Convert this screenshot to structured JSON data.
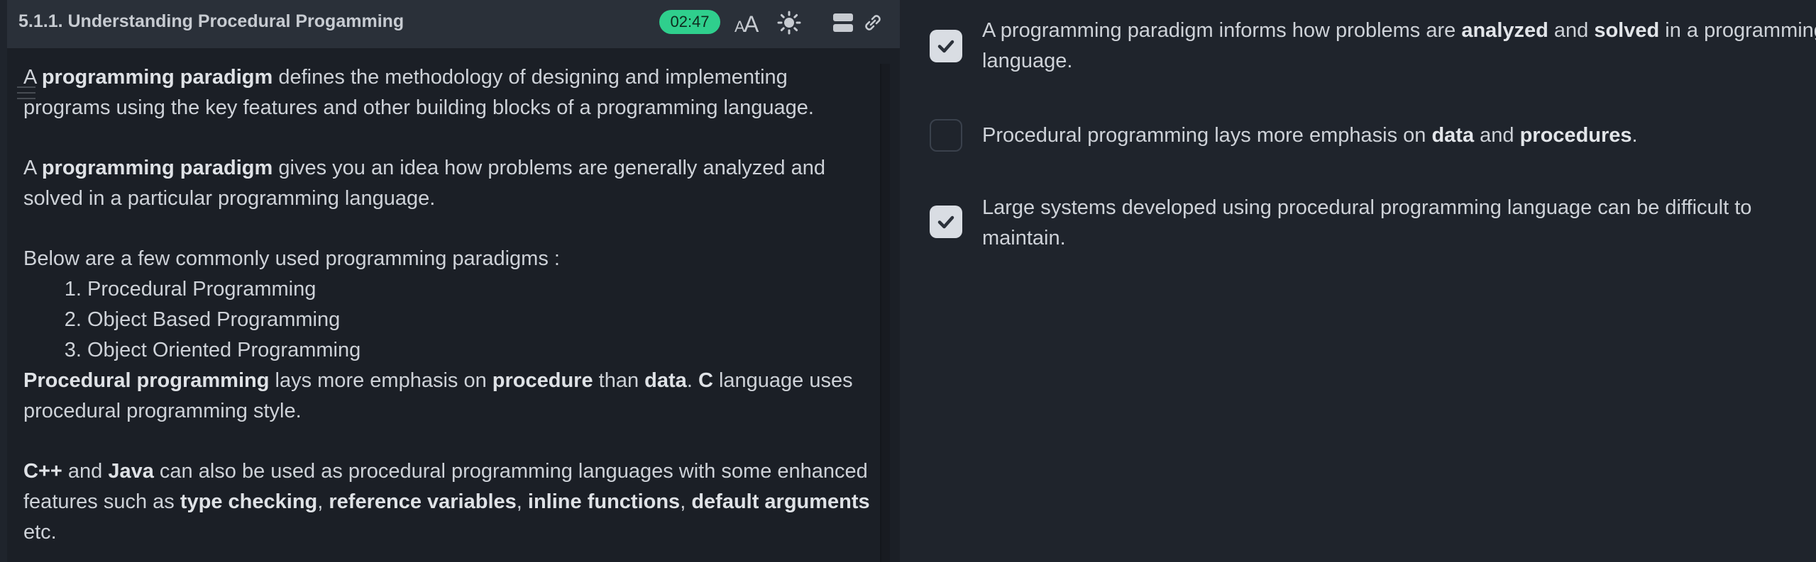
{
  "header": {
    "title": "5.1.1. Understanding Procedural Progamming",
    "timer": "02:47",
    "icons": [
      "font-size-icon",
      "brightness-icon",
      "layout-icon",
      "link-icon"
    ]
  },
  "content": {
    "p1": {
      "a": "A ",
      "b": "programming paradigm",
      "c": " defines the methodology of designing and implementing programs using the key features and other building blocks of a programming language."
    },
    "p2": {
      "a": "A ",
      "b": "programming paradigm",
      "c": " gives you an idea how problems are generally analyzed and solved in a particular programming language."
    },
    "p3": "Below are a few commonly used programming paradigms :",
    "list": [
      "Procedural Programming",
      "Object Based Programming",
      "Object Oriented Programming"
    ],
    "p4": {
      "a": "Procedural programming",
      "b": " lays more emphasis on ",
      "c": "procedure",
      "d": " than ",
      "e": "data",
      "f": ". ",
      "g": "C",
      "h": " language uses procedural programming style."
    },
    "p5": {
      "a": "C++",
      "b": " and ",
      "c": "Java",
      "d": " can also be used as procedural programming languages with some enhanced features such as ",
      "e": "type checking",
      "f": ", ",
      "g": "reference variables",
      "h": ", ",
      "i": "inline functions",
      "j": ", ",
      "k": "default arguments",
      "l": " etc."
    }
  },
  "options": [
    {
      "checked": true,
      "a": "A programming paradigm informs how problems are ",
      "b": "analyzed",
      "c": " and ",
      "d": "solved",
      "e": " in a programming language."
    },
    {
      "checked": false,
      "a": "Procedural programming lays more emphasis on ",
      "b": "data",
      "c": " and ",
      "d": "procedures",
      "e": "."
    },
    {
      "checked": true,
      "a": "Large systems developed using procedural programming language can be difficult to maintain."
    }
  ],
  "colors": {
    "timer_bg": "#2fcf8d",
    "panel_bg": "#1b1f26",
    "header_bg": "#2a3039",
    "checkbox_checked": "#d9dde3"
  }
}
